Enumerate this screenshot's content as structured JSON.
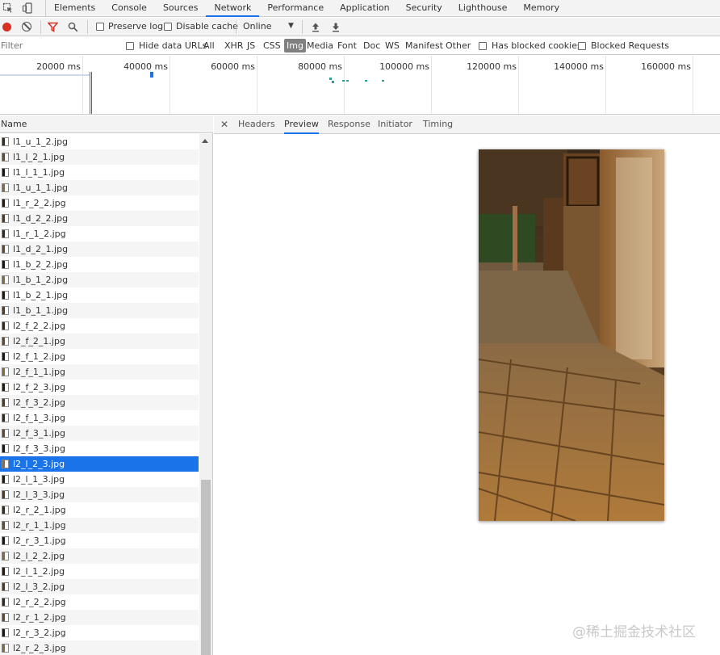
{
  "tabs": [
    "Elements",
    "Console",
    "Sources",
    "Network",
    "Performance",
    "Application",
    "Security",
    "Lighthouse",
    "Memory"
  ],
  "active_tab": "Network",
  "toolbar": {
    "preserve_log": "Preserve log",
    "disable_cache": "Disable cache",
    "throttling": "Online"
  },
  "filter": {
    "placeholder": "Filter",
    "hide_data_urls": "Hide data URLs",
    "types": [
      "All",
      "XHR",
      "JS",
      "CSS",
      "Img",
      "Media",
      "Font",
      "Doc",
      "WS",
      "Manifest",
      "Other"
    ],
    "selected_type": "Img",
    "has_blocked_cookies": "Has blocked cookies",
    "blocked_requests": "Blocked Requests"
  },
  "overview": {
    "ticks": [
      "20000 ms",
      "40000 ms",
      "60000 ms",
      "80000 ms",
      "100000 ms",
      "120000 ms",
      "140000 ms",
      "160000 ms"
    ]
  },
  "list": {
    "header": "Name",
    "selected": "l2_l_2_3.jpg",
    "rows": [
      "l1_u_1_2.jpg",
      "l1_l_2_1.jpg",
      "l1_l_1_1.jpg",
      "l1_u_1_1.jpg",
      "l1_r_2_2.jpg",
      "l1_d_2_2.jpg",
      "l1_r_1_2.jpg",
      "l1_d_2_1.jpg",
      "l1_b_2_2.jpg",
      "l1_b_1_2.jpg",
      "l1_b_2_1.jpg",
      "l1_b_1_1.jpg",
      "l2_f_2_2.jpg",
      "l2_f_2_1.jpg",
      "l2_f_1_2.jpg",
      "l2_f_1_1.jpg",
      "l2_f_2_3.jpg",
      "l2_f_3_2.jpg",
      "l2_f_1_3.jpg",
      "l2_f_3_1.jpg",
      "l2_f_3_3.jpg",
      "l2_l_2_3.jpg",
      "l2_l_1_3.jpg",
      "l2_l_3_3.jpg",
      "l2_r_2_1.jpg",
      "l2_r_1_1.jpg",
      "l2_r_3_1.jpg",
      "l2_l_2_2.jpg",
      "l2_l_1_2.jpg",
      "l2_l_3_2.jpg",
      "l2_r_2_2.jpg",
      "l2_r_1_2.jpg",
      "l2_r_3_2.jpg",
      "l2_r_2_3.jpg"
    ]
  },
  "detail": {
    "tabs": [
      "Headers",
      "Preview",
      "Response",
      "Initiator",
      "Timing"
    ],
    "active": "Preview"
  },
  "watermark": "@稀土掘金技术社区",
  "colors": {
    "accent": "#1a73e8",
    "record": "#d93025",
    "filter_icon": "#d93025"
  }
}
